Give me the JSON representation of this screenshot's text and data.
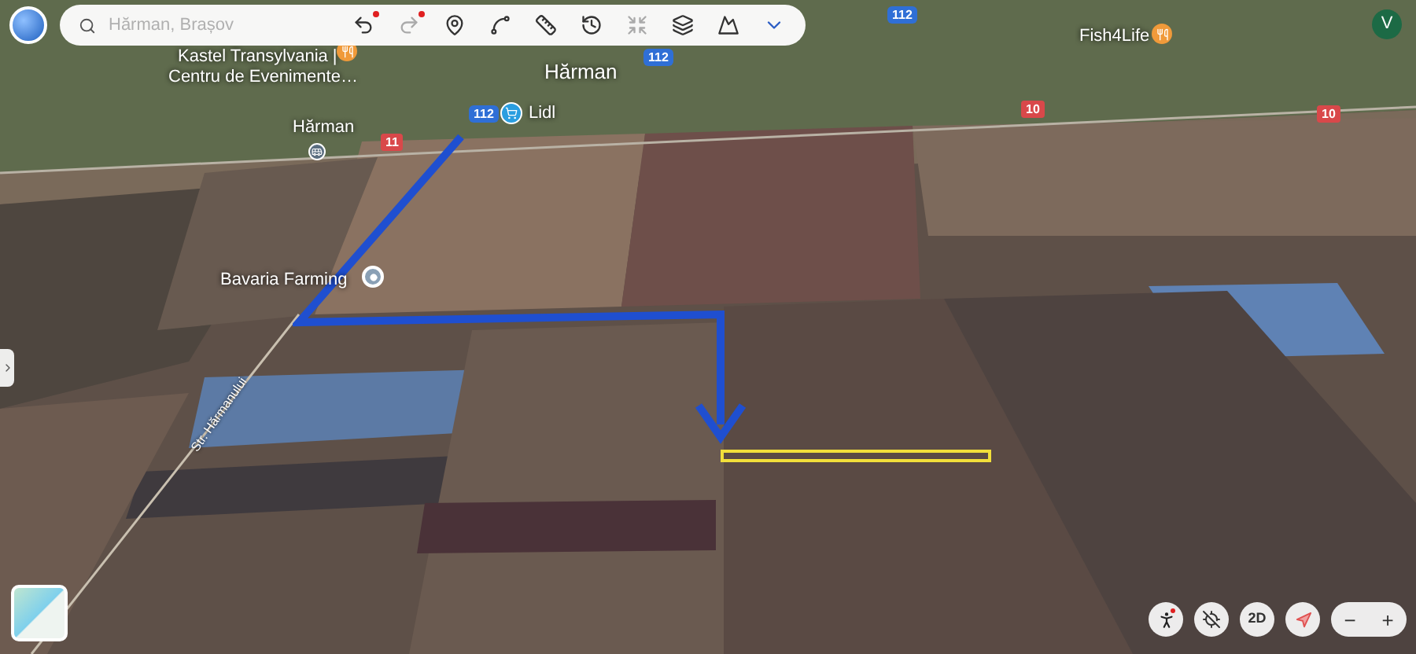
{
  "search": {
    "placeholder": "Hărman, Brașov"
  },
  "toolbar": [
    {
      "kind": "undo",
      "dot": true,
      "disabled": false
    },
    {
      "kind": "redo",
      "dot": true,
      "disabled": true
    },
    {
      "kind": "pin",
      "dot": false,
      "disabled": false
    },
    {
      "kind": "path",
      "dot": false,
      "disabled": false
    },
    {
      "kind": "ruler",
      "dot": false,
      "disabled": false
    },
    {
      "kind": "history",
      "dot": false,
      "disabled": false
    },
    {
      "kind": "crossed",
      "dot": false,
      "disabled": true
    },
    {
      "kind": "layers",
      "dot": false,
      "disabled": false
    },
    {
      "kind": "image",
      "dot": false,
      "disabled": false
    },
    {
      "kind": "more",
      "dot": false,
      "disabled": false
    }
  ],
  "account": {
    "initial": "V"
  },
  "map_labels": [
    {
      "kind": "place",
      "text": "Kastel Transylvania |"
    },
    {
      "kind": "place",
      "text": "Centru de Evenimente…"
    },
    {
      "kind": "town",
      "text": "Hărman"
    },
    {
      "kind": "place",
      "text": "Hărman"
    },
    {
      "kind": "place",
      "text": "Lidl"
    },
    {
      "kind": "place",
      "text": "Fish4Life"
    },
    {
      "kind": "place",
      "text": "Bavaria Farming"
    },
    {
      "kind": "street",
      "text": "Str. Hărmanului"
    },
    {
      "kind": "national-road",
      "text": "112"
    },
    {
      "kind": "national-road",
      "text": "112"
    },
    {
      "kind": "national-road",
      "text": "112"
    },
    {
      "kind": "county-road",
      "text": "11"
    },
    {
      "kind": "county-road",
      "text": "10"
    },
    {
      "kind": "county-road",
      "text": "10"
    }
  ],
  "view_controls": {
    "pegman_dot": true,
    "mode": "2D",
    "zoom_out": "−",
    "zoom_in": "+"
  }
}
